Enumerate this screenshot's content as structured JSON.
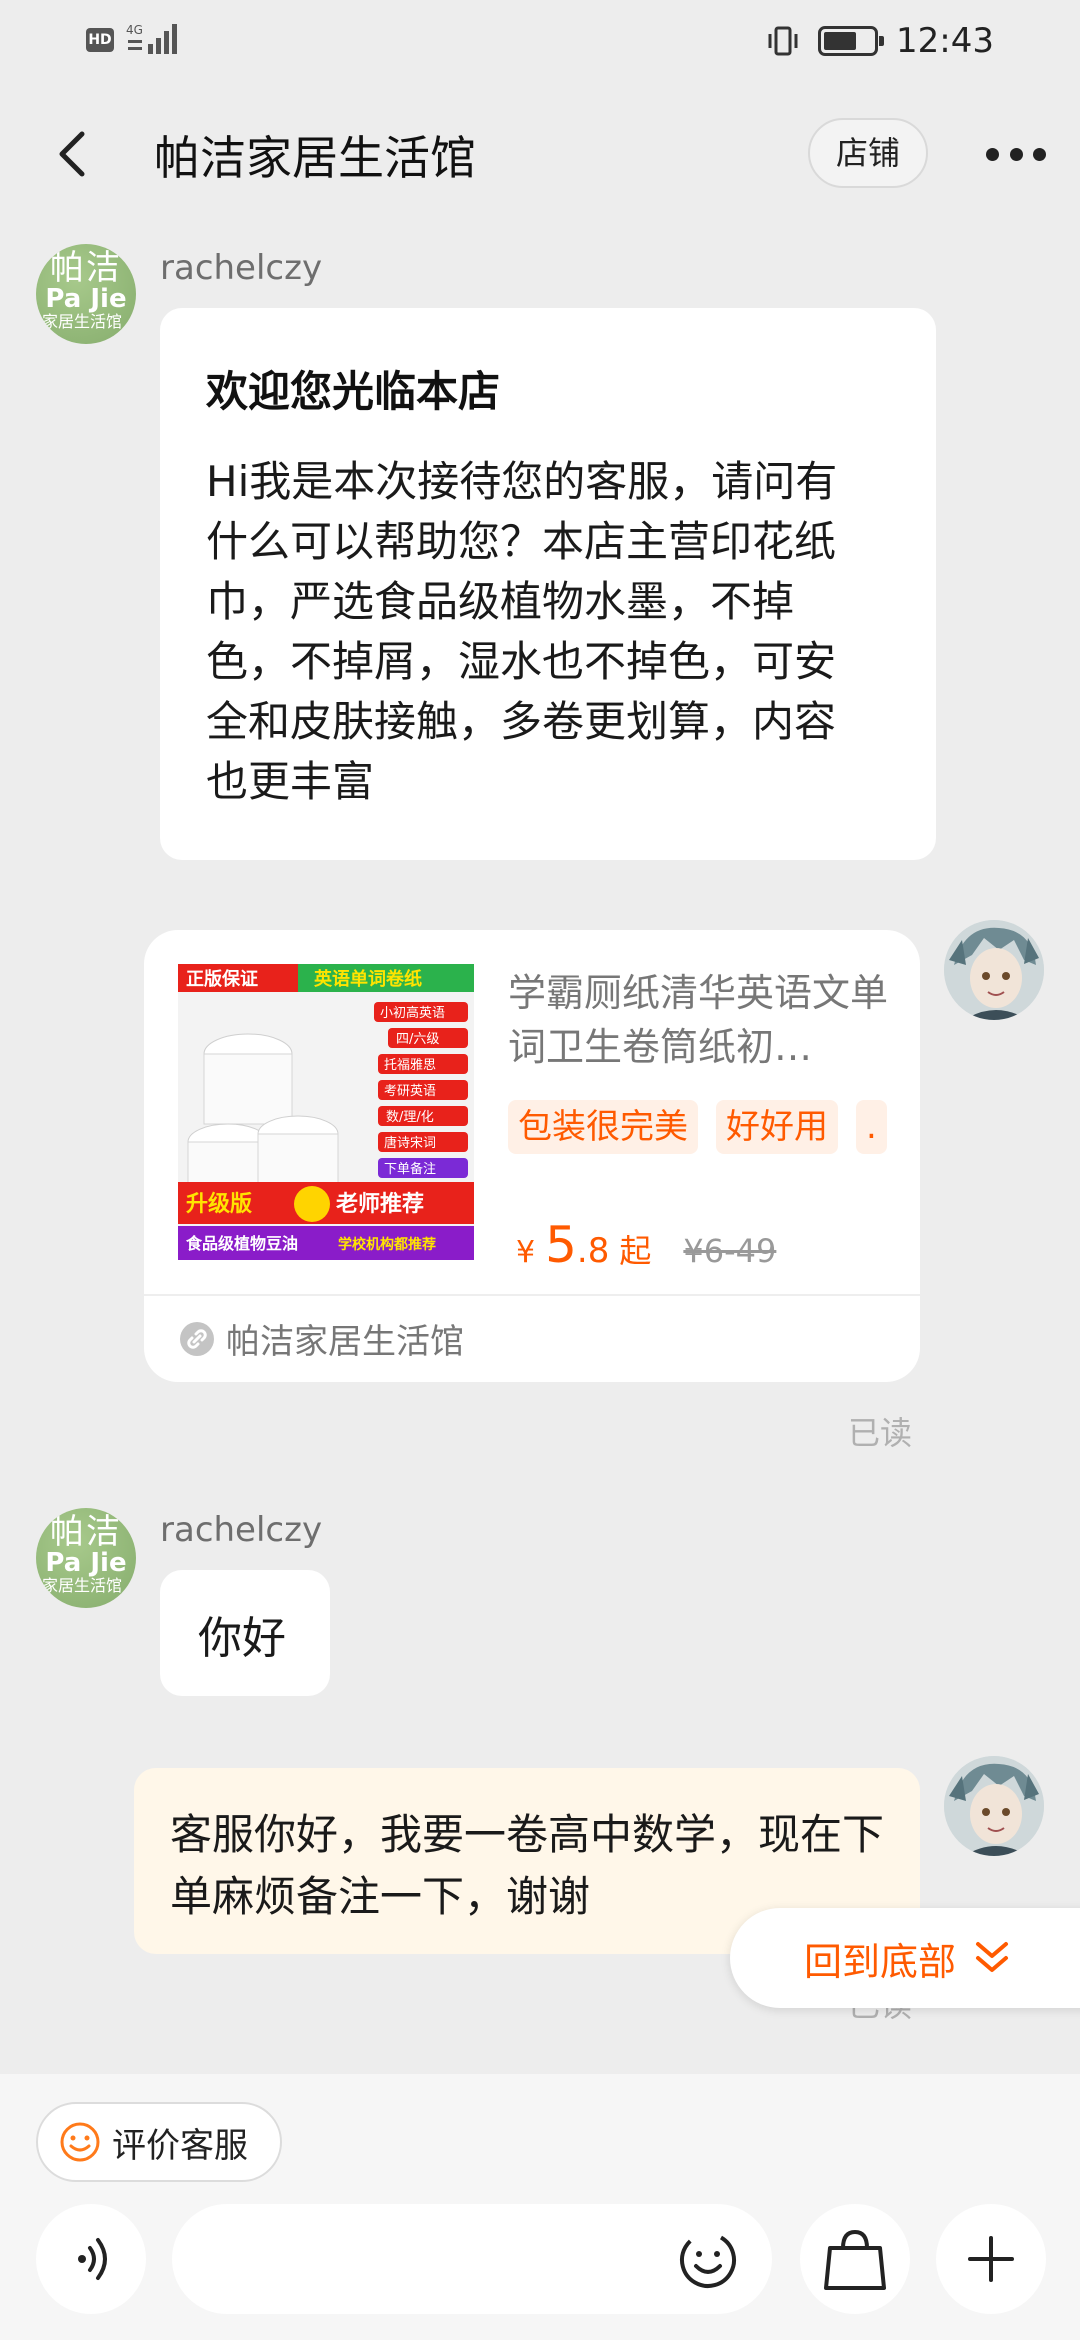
{
  "status_bar": {
    "network": "HD",
    "signal_label": "4G",
    "time": "12:43"
  },
  "nav": {
    "title": "帕洁家居生活馆",
    "shop_button": "店铺"
  },
  "shop_avatar": {
    "line1": "帕洁",
    "line2": "Pa Jie",
    "line3": "家居生活馆"
  },
  "messages": {
    "welcome": {
      "sender": "rachelczy",
      "title": "欢迎您光临本店",
      "body": "Hi我是本次接待您的客服，请问有什么可以帮助您？本店主营印花纸巾，严选食品级植物水墨，不掉色，不掉屑，湿水也不掉色，可安全和皮肤接触，多卷更划算，内容也更丰富"
    },
    "product_card": {
      "image_labels": {
        "top_left": "正版保证",
        "top_right": "英语单词卷纸",
        "tags": [
          "小初高英语",
          "四/六级",
          "托福雅思",
          "考研英语",
          "数/理/化",
          "唐诗宋词",
          "下单备注"
        ],
        "upgrade": "升级版",
        "recommend": "老师推荐",
        "footer_left": "食品级植物豆油",
        "footer_right": "学校机构都推荐"
      },
      "title": "学霸厕纸清华英语文单词卫生卷筒纸初…",
      "tags": [
        "包装很完美",
        "好好用",
        "."
      ],
      "price_currency": "¥",
      "price_main": "5",
      "price_decimal": ".8",
      "price_suffix": "起",
      "original_price": "¥6-49",
      "shop_name": "帕洁家居生活馆",
      "read_status": "已读"
    },
    "greeting": {
      "sender": "rachelczy",
      "text": "你好"
    },
    "user_message": {
      "text": "客服你好，我要一卷高中数学，现在下单麻烦备注一下，谢谢",
      "read_status": "已读"
    }
  },
  "floating": {
    "back_to_bottom": "回到底部"
  },
  "bottom_bar": {
    "rate_service": "评价客服",
    "icons": [
      "voice-icon",
      "emoji-icon",
      "shopping-bag-icon",
      "plus-icon"
    ]
  },
  "colors": {
    "accent": "#ff5a00",
    "user_bubble": "#fff7e9",
    "background": "#ededed"
  }
}
